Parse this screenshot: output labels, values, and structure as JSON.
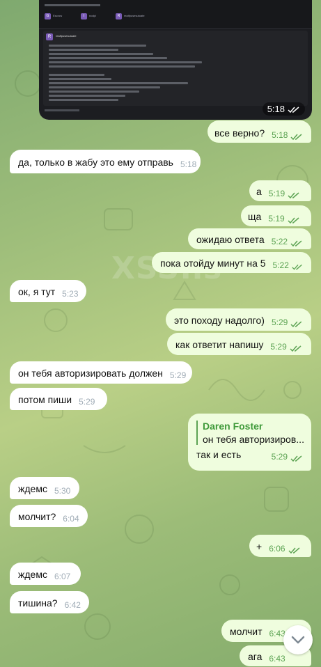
{
  "watermark": "XSS.is",
  "screenshot": {
    "time": "5:18",
    "header_chips": [
      "Escrow",
      "nodpi",
      "realfpusesutoate"
    ],
    "post_author": "realfpusesutoate"
  },
  "messages": [
    {
      "id": "m1",
      "dir": "out",
      "text": "все верно?",
      "time": "5:18"
    },
    {
      "id": "m2",
      "dir": "in",
      "text": "да, только в жабу это ему отправь",
      "time": "5:18"
    },
    {
      "id": "m3",
      "dir": "out",
      "text": "а",
      "time": "5:19"
    },
    {
      "id": "m4",
      "dir": "out",
      "text": "ща",
      "time": "5:19"
    },
    {
      "id": "m5",
      "dir": "out",
      "text": "ожидаю ответа",
      "time": "5:22"
    },
    {
      "id": "m6",
      "dir": "out",
      "text": "пока отойду минут на 5",
      "time": "5:22"
    },
    {
      "id": "m7",
      "dir": "in",
      "text": "ок, я тут",
      "time": "5:23"
    },
    {
      "id": "m8",
      "dir": "out",
      "text": "это походу надолго)",
      "time": "5:29"
    },
    {
      "id": "m9",
      "dir": "out",
      "text": "как ответит напишу",
      "time": "5:29"
    },
    {
      "id": "m10",
      "dir": "in",
      "text": "он тебя авторизировать должен",
      "time": "5:29"
    },
    {
      "id": "m11",
      "dir": "in",
      "text": "потом пиши",
      "time": "5:29"
    },
    {
      "id": "m13",
      "dir": "in",
      "text": "ждемс",
      "time": "5:30"
    },
    {
      "id": "m14",
      "dir": "in",
      "text": "молчит?",
      "time": "6:04"
    },
    {
      "id": "m15",
      "dir": "out",
      "text": "+",
      "time": "6:06"
    },
    {
      "id": "m16",
      "dir": "in",
      "text": "ждемс",
      "time": "6:07"
    },
    {
      "id": "m17",
      "dir": "in",
      "text": "тишина?",
      "time": "6:42"
    },
    {
      "id": "m18",
      "dir": "out",
      "text": "молчит",
      "time": "6:43"
    },
    {
      "id": "m19",
      "dir": "out",
      "text": "ага",
      "time": "6:43"
    }
  ],
  "reply_message": {
    "reply_to_name": "Daren Foster",
    "reply_to_text": "он тебя авторизиров...",
    "text": "так и есть",
    "time": "5:29"
  }
}
